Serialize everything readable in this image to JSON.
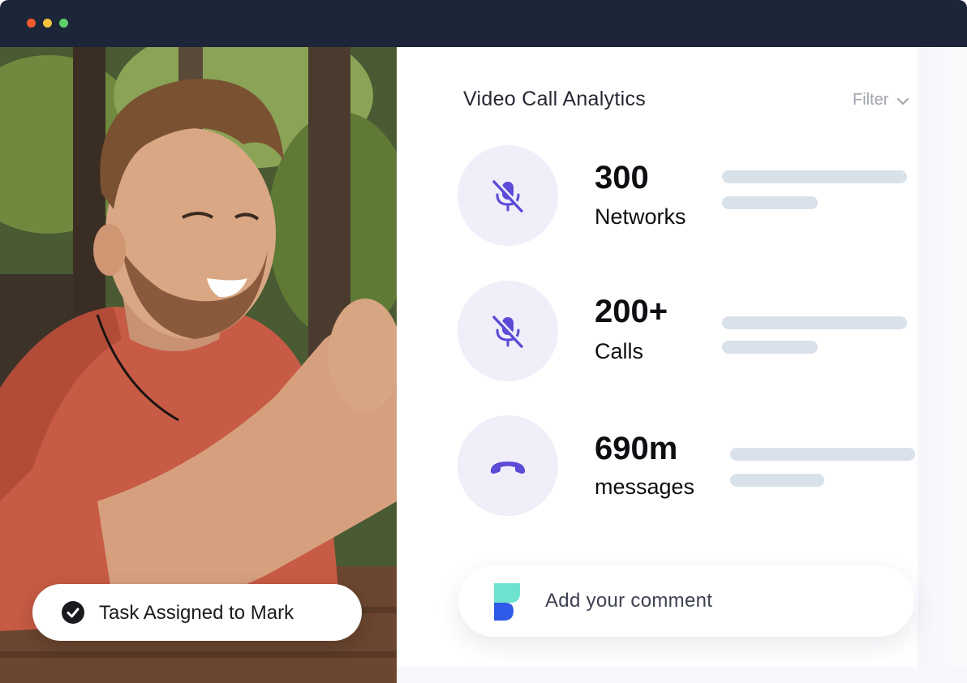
{
  "window": {
    "controls": [
      "close",
      "minimize",
      "maximize"
    ]
  },
  "photo": {
    "icon": "person-laughing-photo"
  },
  "task_badge": {
    "text": "Task Assigned to Mark",
    "icon": "check-circle-icon"
  },
  "panel": {
    "title": "Video Call Analytics",
    "filter_label": "Filter",
    "stats": [
      {
        "value": "300",
        "label": "Networks",
        "icon": "mic-off-icon"
      },
      {
        "value": "200+",
        "label": "Calls",
        "icon": "mic-off-icon"
      },
      {
        "value": "690m",
        "label": "messages",
        "icon": "phone-hangup-icon"
      }
    ],
    "comment_placeholder": "Add your comment"
  },
  "colors": {
    "accent": "#5b4bd6",
    "titlebar": "#1d2538",
    "circle_bg": "#efeef9",
    "bar": "#d9e2ea",
    "logo_teal": "#6de3cf",
    "logo_blue": "#2f5be8"
  }
}
